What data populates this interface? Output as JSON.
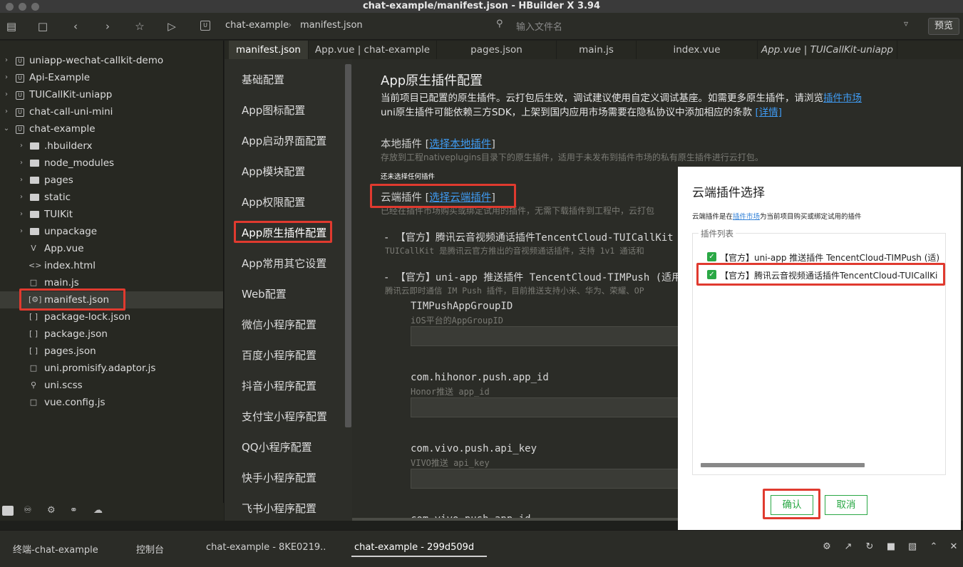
{
  "window": {
    "title": "chat-example/manifest.json - HBuilder X 3.94"
  },
  "toolbar": {
    "breadcrumb": [
      "chat-example",
      "manifest.json"
    ],
    "search_placeholder": "输入文件名",
    "preview_label": "预览"
  },
  "sidebar": {
    "items": [
      {
        "label": "uniapp-wechat-callkit-demo",
        "type": "project"
      },
      {
        "label": "Api-Example",
        "type": "project"
      },
      {
        "label": "TUICallKit-uniapp",
        "type": "project"
      },
      {
        "label": "chat-call-uni-mini",
        "type": "project"
      },
      {
        "label": "chat-example",
        "type": "project"
      },
      {
        "label": ".hbuilderx",
        "type": "folder"
      },
      {
        "label": "node_modules",
        "type": "folder"
      },
      {
        "label": "pages",
        "type": "folder"
      },
      {
        "label": "static",
        "type": "folder"
      },
      {
        "label": "TUIKit",
        "type": "folder"
      },
      {
        "label": "unpackage",
        "type": "folder"
      },
      {
        "label": "App.vue",
        "type": "file",
        "icon": "V"
      },
      {
        "label": "index.html",
        "type": "file",
        "icon": "<>"
      },
      {
        "label": "main.js",
        "type": "file",
        "icon": ""
      },
      {
        "label": "manifest.json",
        "type": "file",
        "icon": "[⚙]"
      },
      {
        "label": "package-lock.json",
        "type": "file",
        "icon": "[ ]"
      },
      {
        "label": "package.json",
        "type": "file",
        "icon": "[ ]"
      },
      {
        "label": "pages.json",
        "type": "file",
        "icon": "[ ]"
      },
      {
        "label": "uni.promisify.adaptor.js",
        "type": "file",
        "icon": ""
      },
      {
        "label": "uni.scss",
        "type": "file",
        "icon": "⚲"
      },
      {
        "label": "vue.config.js",
        "type": "file",
        "icon": ""
      }
    ]
  },
  "tabs": [
    {
      "label": "manifest.json"
    },
    {
      "label": "App.vue | chat-example"
    },
    {
      "label": "pages.json"
    },
    {
      "label": "main.js"
    },
    {
      "label": "index.vue"
    },
    {
      "label": "App.vue | TUICallKit-uniapp"
    }
  ],
  "config_nav": [
    {
      "label": "基础配置"
    },
    {
      "label": "App图标配置"
    },
    {
      "label": "App启动界面配置"
    },
    {
      "label": "App模块配置"
    },
    {
      "label": "App权限配置"
    },
    {
      "label": "App原生插件配置"
    },
    {
      "label": "App常用其它设置"
    },
    {
      "label": "Web配置"
    },
    {
      "label": "微信小程序配置"
    },
    {
      "label": "百度小程序配置"
    },
    {
      "label": "抖音小程序配置"
    },
    {
      "label": "支付宝小程序配置"
    },
    {
      "label": "QQ小程序配置"
    },
    {
      "label": "快手小程序配置"
    },
    {
      "label": "飞书小程序配置"
    }
  ],
  "main": {
    "heading": "App原生插件配置",
    "desc1": "当前项目已配置的原生插件。云打包后生效，调试建议使用自定义调试基座。如需更多原生插件，请浏览",
    "desc1_link": "插件市场",
    "desc2": "uni原生插件可能依赖三方SDK，上架到国内应用市场需要在隐私协议中添加相应的条款",
    "desc2_link": "[详情]",
    "local_label": "本地插件",
    "local_link": "选择本地插件",
    "local_desc": "存放到工程nativeplugins目录下的原生插件，适用于未发布到插件市场的私有原生插件进行云打包。",
    "local_none": "还未选择任何插件",
    "cloud_label": "云端插件",
    "cloud_link": "选择云端插件",
    "cloud_desc": "已经在插件市场购买或绑定试用的插件，无需下载插件到工程中，云打包",
    "plugin1_title": "- 【官方】腾讯云音视频通话插件TencentCloud-TUICallKit",
    "plugin1_desc": "TUICallKit 是腾讯云官方推出的音视频通话插件，支持 1v1 通话和",
    "plugin2_title": "- 【官方】uni-app 推送插件 TencentCloud-TIMPush (适用",
    "plugin2_desc": "腾讯云即时通信 IM Push 插件，目前推送支持小米、华为、荣耀、OP",
    "fields": [
      {
        "key": "TIMPushAppGroupID",
        "desc": "iOS平台的AppGroupID"
      },
      {
        "key": "com.hihonor.push.app_id",
        "desc": "Honor推送 app_id"
      },
      {
        "key": "com.vivo.push.api_key",
        "desc": "VIVO推送 api_key"
      },
      {
        "key": "com.vivo.push.app_id",
        "desc": ""
      }
    ]
  },
  "dialog": {
    "title": "云端插件选择",
    "subtitle_pre": "云端插件是在",
    "subtitle_link": "插件市场",
    "subtitle_post": "为当前项目购买或绑定试用的插件",
    "list_legend": "插件列表",
    "items": [
      {
        "label": "【官方】uni-app 推送插件 TencentCloud-TIMPush (适)",
        "checked": true
      },
      {
        "label": "【官方】腾讯云音视频通话插件TencentCloud-TUICallKi",
        "checked": true
      }
    ],
    "confirm_label": "确认",
    "cancel_label": "取消"
  },
  "bottom": {
    "tabs": [
      {
        "label": "终端-chat-example"
      },
      {
        "label": "控制台"
      },
      {
        "label": "chat-example - 8KE0219.."
      },
      {
        "label": "chat-example - 299d509d"
      }
    ]
  },
  "colors": {
    "accent_green": "#2aa845",
    "highlight_red": "#e03a2f",
    "link_blue": "#3f9bf2"
  }
}
